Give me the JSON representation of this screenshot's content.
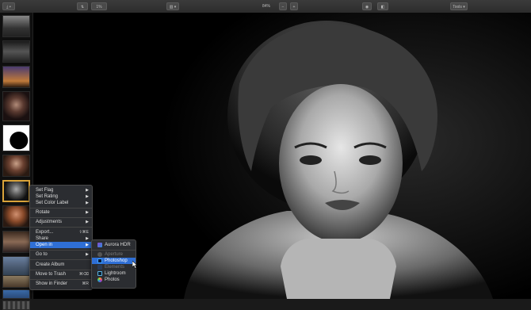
{
  "toolbar": {
    "zoom": "84%",
    "zoom_minus": "−",
    "zoom_plus": "+",
    "tools_label": "Tools",
    "view_value": "1%"
  },
  "sidebar": {
    "thumbnails": [
      "street",
      "night-street",
      "sunset",
      "portrait",
      "silhouette",
      "woman-hair",
      "selected-portrait",
      "redhead",
      "woman-sitting",
      "city",
      "cafe",
      "ocean",
      "grid"
    ]
  },
  "context_menu": {
    "items": [
      {
        "label": "Set Flag",
        "arrow": "▶"
      },
      {
        "label": "Set Rating",
        "arrow": "▶"
      },
      {
        "label": "Set Color Label",
        "arrow": "▶"
      },
      {
        "label": "Rotate",
        "arrow": "▶"
      },
      {
        "label": "Adjustments",
        "arrow": "▶"
      },
      {
        "label": "Export...",
        "shortcut": "⇧⌘E"
      },
      {
        "label": "Share",
        "arrow": "▶"
      },
      {
        "label": "Open in",
        "arrow": "▶"
      },
      {
        "label": "Go to",
        "arrow": "▶"
      },
      {
        "label": "Create Album"
      },
      {
        "label": "Move to Trash",
        "shortcut": "⌘⌫"
      },
      {
        "label": "Show in Finder",
        "shortcut": "⌘R"
      }
    ]
  },
  "submenu": {
    "items": [
      {
        "label": "Aurora HDR"
      },
      {
        "label": "Aperture"
      },
      {
        "label": "Photoshop"
      },
      {
        "label": "Elements"
      },
      {
        "label": "Lightroom"
      },
      {
        "label": "Photos"
      }
    ]
  },
  "colors": {
    "highlight": "#2f6fd6",
    "selection_border": "#d9a33a"
  }
}
